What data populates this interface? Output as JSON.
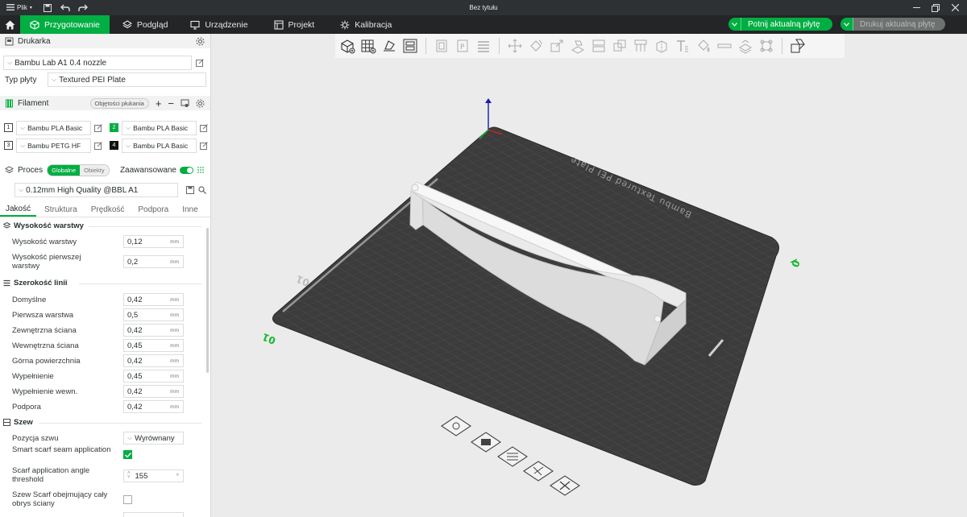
{
  "titlebar": {
    "menu_label": "Plik",
    "window_title": "Bez tytułu"
  },
  "tabs": [
    {
      "label": "Przygotowanie",
      "icon": "cube-icon",
      "active": true
    },
    {
      "label": "Podgląd",
      "icon": "layers-icon",
      "active": false
    },
    {
      "label": "Urządzenie",
      "icon": "monitor-icon",
      "active": false
    },
    {
      "label": "Projekt",
      "icon": "project-icon",
      "active": false
    },
    {
      "label": "Kalibracja",
      "icon": "calibration-icon",
      "active": false
    }
  ],
  "actions": {
    "slice_label": "Potnij aktualną płytę",
    "print_label": "Drukuj aktualną płytę"
  },
  "printer": {
    "header": "Drukarka",
    "printer_name": "Bambu Lab A1 0.4 nozzle",
    "plate_label": "Typ płyty",
    "plate_value": "Textured PEI Plate"
  },
  "filament": {
    "header": "Filament",
    "flush_label": "Objętości płukania",
    "slots": [
      {
        "num": "1",
        "name": "Bambu PLA Basic",
        "color": "#ffffff"
      },
      {
        "num": "2",
        "name": "Bambu PLA Basic",
        "color": "#00ae42"
      },
      {
        "num": "3",
        "name": "Bambu PETG HF",
        "color": "#ffffff"
      },
      {
        "num": "4",
        "name": "Bambu PLA Basic",
        "color": "#111111"
      }
    ]
  },
  "process": {
    "header": "Proces",
    "global_label": "Globalne",
    "objects_label": "Obiekty",
    "advanced_label": "Zaawansowane",
    "profile": "0.12mm High Quality @BBL A1",
    "subtabs": [
      "Jakość",
      "Struktura",
      "Prędkość",
      "Podpora",
      "Inne"
    ]
  },
  "quality": {
    "layer_group": "Wysokość warstwy",
    "layer_rows": [
      {
        "label": "Wysokość warstwy",
        "value": "0,12",
        "unit": "mm"
      },
      {
        "label": "Wysokość pierwszej warstwy",
        "value": "0,2",
        "unit": "mm"
      }
    ],
    "width_group": "Szerokość linii",
    "width_rows": [
      {
        "label": "Domyślne",
        "value": "0,42",
        "unit": "mm"
      },
      {
        "label": "Pierwsza warstwa",
        "value": "0,5",
        "unit": "mm"
      },
      {
        "label": "Zewnętrzna ściana",
        "value": "0,42",
        "unit": "mm"
      },
      {
        "label": "Wewnętrzna ściana",
        "value": "0,45",
        "unit": "mm"
      },
      {
        "label": "Górna powierzchnia",
        "value": "0,42",
        "unit": "mm"
      },
      {
        "label": "Wypełnienie",
        "value": "0,45",
        "unit": "mm"
      },
      {
        "label": "Wypełnienie wewn.",
        "value": "0,42",
        "unit": "mm"
      },
      {
        "label": "Podpora",
        "value": "0,42",
        "unit": "mm"
      }
    ],
    "seam_group": "Szew",
    "seam_position_label": "Pozycja szwu",
    "seam_position_value": "Wyrównany",
    "smart_scarf_label": "Smart scarf seam application",
    "scarf_angle_label": "Scarf application angle threshold",
    "scarf_angle_value": "155",
    "scarf_full_label": "Szew Scarf obejmujący cały obrys ściany"
  },
  "plate": {
    "bed_label": "Bambu Textured PEI Plate",
    "plate_number": "01"
  }
}
